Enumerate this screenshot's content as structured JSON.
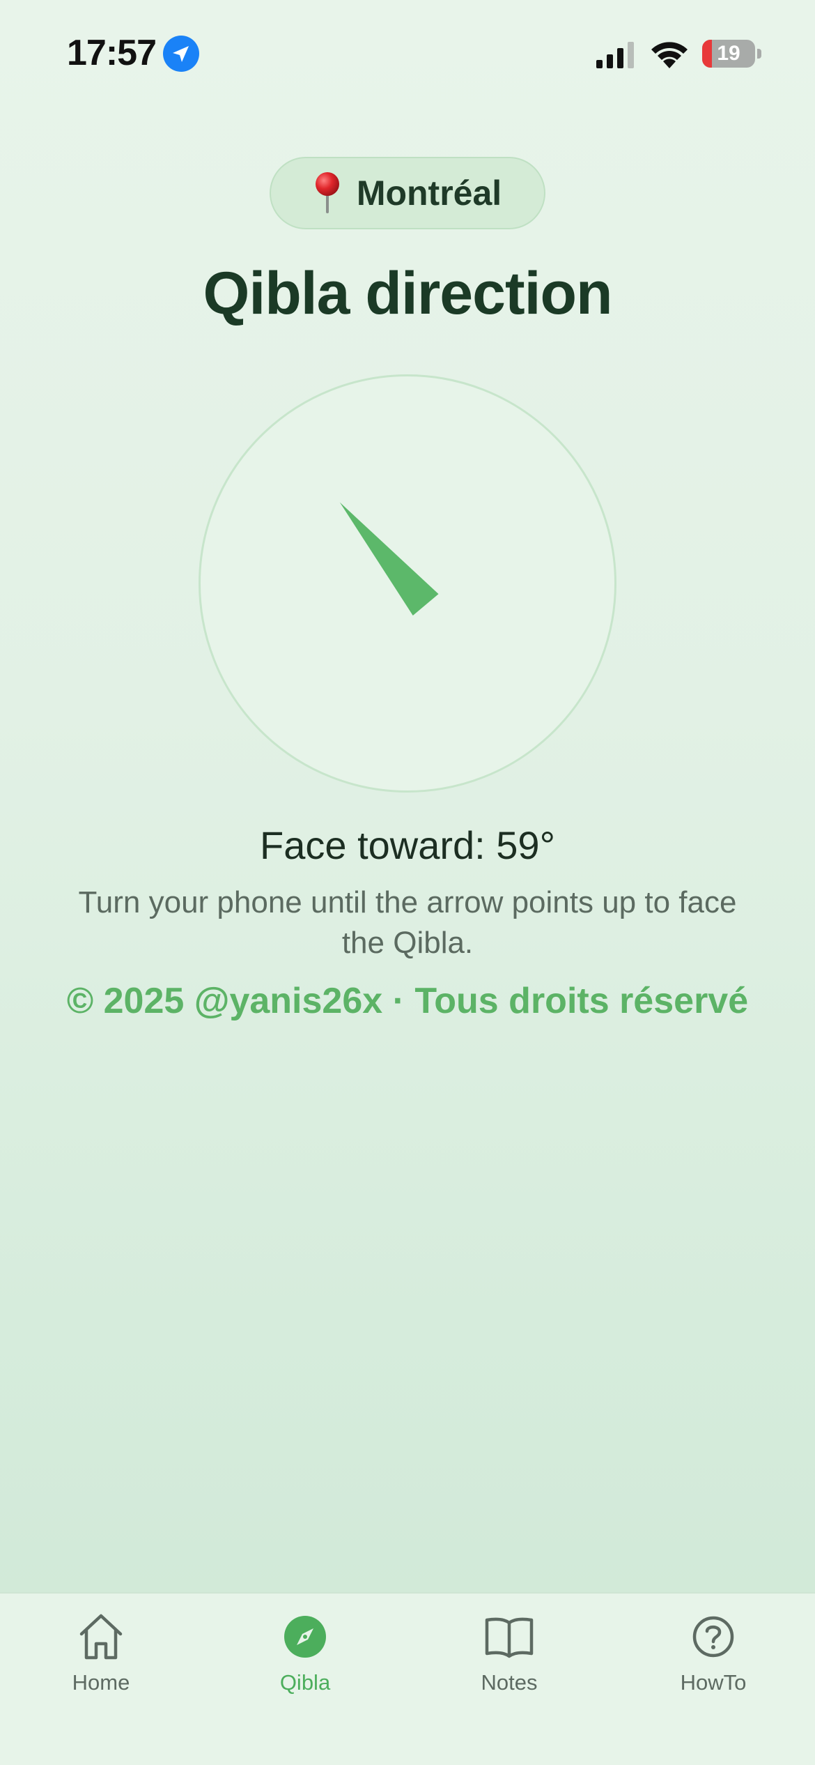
{
  "status_bar": {
    "time": "17:57",
    "battery_level": "19",
    "battery_fraction": 0.19,
    "icons": [
      "location-arrow-icon",
      "signal-icon",
      "wifi-icon",
      "battery-icon"
    ]
  },
  "location": {
    "icon": "pushpin-icon",
    "name": "Montréal"
  },
  "title": "Qibla direction",
  "compass": {
    "heading_degrees": 59,
    "arrow_color": "#5cb86a"
  },
  "face_toward": "Face toward: 59°",
  "instruction": "Turn your phone until the arrow points up to face the Qibla.",
  "copyright": "© 2025 @yanis26x · Tous droits réservé",
  "colors": {
    "accent": "#4cae5c",
    "title": "#1b3a26",
    "background": "#e2f1e5"
  },
  "tab_bar": {
    "active": "Qibla",
    "tabs": [
      {
        "label": "Home",
        "icon": "house-icon"
      },
      {
        "label": "Qibla",
        "icon": "compass-icon"
      },
      {
        "label": "Notes",
        "icon": "book-icon"
      },
      {
        "label": "HowTo",
        "icon": "question-circle-icon"
      }
    ]
  }
}
